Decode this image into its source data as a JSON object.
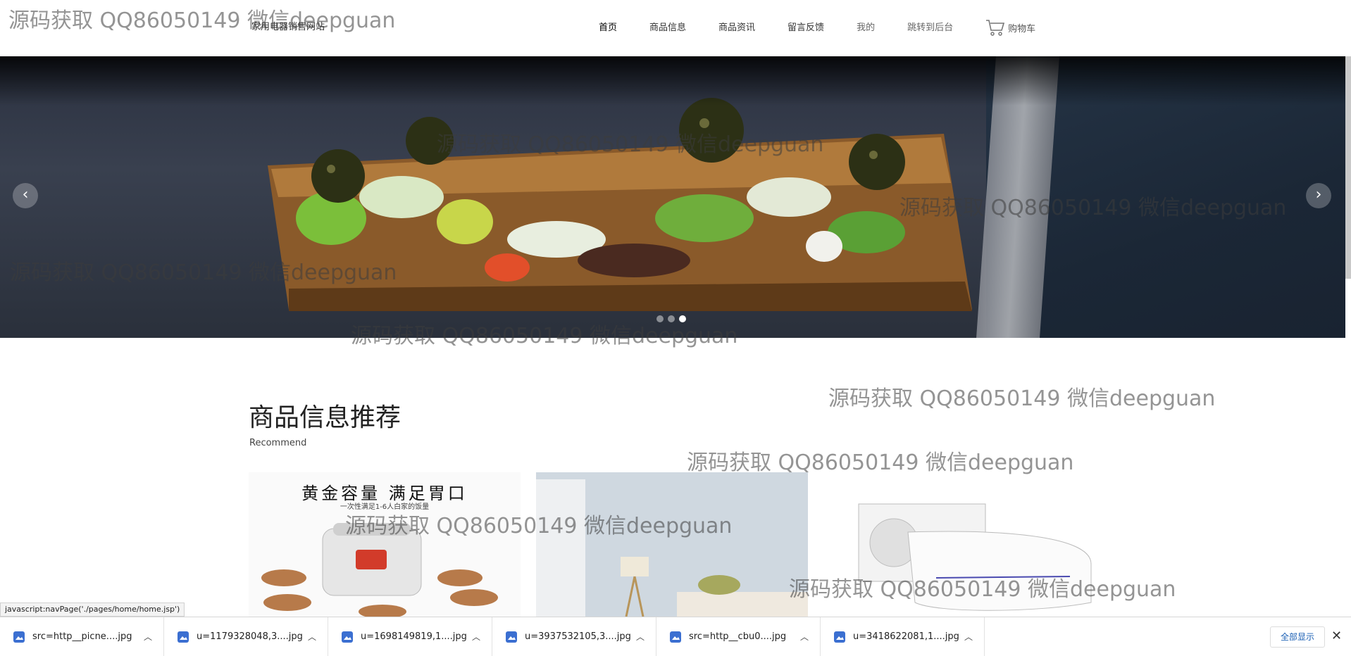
{
  "header": {
    "site_name": "家用电器销售网站",
    "nav": [
      {
        "label": "首页"
      },
      {
        "label": "商品信息"
      },
      {
        "label": "商品资讯"
      },
      {
        "label": "留言反馈"
      },
      {
        "label": "我的"
      },
      {
        "label": "跳转到后台"
      }
    ],
    "cart_label": "购物车"
  },
  "slider": {
    "prev": "‹",
    "next": "›",
    "active_dot": 3,
    "dot_count": 3
  },
  "section": {
    "title": "商品信息推荐",
    "subtitle": "Recommend"
  },
  "cards": [
    {
      "caption": "黄金容量 满足胃口",
      "subcaption": "一次性满足1-6人白家的饭量"
    },
    {
      "caption": ""
    },
    {
      "caption": ""
    }
  ],
  "watermark": "源码获取 QQ86050149 微信deepguan",
  "status_bar": "javascript:navPage('./pages/home/home.jsp')",
  "downloads": {
    "items": [
      {
        "name": "src=http__picne....jpg"
      },
      {
        "name": "u=1179328048,3....jpg"
      },
      {
        "name": "u=1698149819,1....jpg"
      },
      {
        "name": "u=3937532105,3....jpg"
      },
      {
        "name": "src=http__cbu0....jpg"
      },
      {
        "name": "u=3418622081,1....jpg"
      }
    ],
    "show_all": "全部显示",
    "close": "✕"
  },
  "colors": {
    "accent_link": "#1a5fb4"
  }
}
